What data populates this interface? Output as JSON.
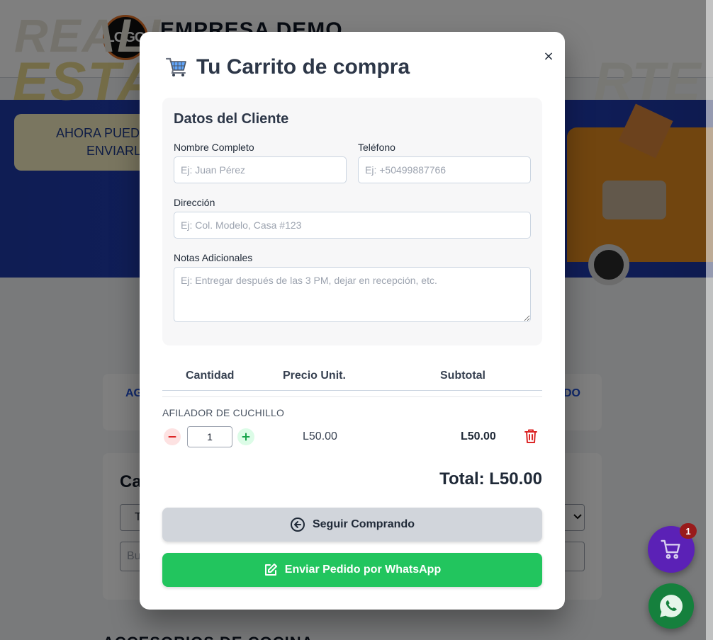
{
  "background": {
    "logo_text": "LOGO",
    "brand": "EMPRESA DEMO",
    "banner": {
      "line1": "REALI",
      "line2": "ESTA",
      "line2_right": "RTE",
      "sub1": "AHORA PUED",
      "sub2": "ENVIARL"
    },
    "nav_left": "AG",
    "nav_right": "DO",
    "filter_title": "Ca",
    "filter_select": "T",
    "search_placeholder": "Bu",
    "section_title": "ACCESORIOS DE COCINA"
  },
  "modal": {
    "cart_icon": "🛒",
    "title": "Tu Carrito de compra",
    "close_label": "×",
    "client": {
      "title": "Datos del Cliente",
      "name_label": "Nombre Completo",
      "name_placeholder": "Ej: Juan Pérez",
      "phone_label": "Teléfono",
      "phone_placeholder": "Ej: +50499887766",
      "address_label": "Dirección",
      "address_placeholder": "Ej: Col. Modelo, Casa #123",
      "notes_label": "Notas Adicionales",
      "notes_placeholder": "Ej: Entregar después de las 3 PM, dejar en recepción, etc."
    },
    "table": {
      "headers": [
        "Cantidad",
        "Precio Unit.",
        "Subtotal"
      ],
      "items": [
        {
          "name": "AFILADOR DE CUCHILLO",
          "quantity": "1",
          "unit_price": "L50.00",
          "subtotal": "L50.00"
        }
      ]
    },
    "total": "Total: L50.00",
    "continue_label": "Seguir Comprando",
    "whatsapp_label": "Enviar Pedido por WhatsApp"
  },
  "floating": {
    "cart_badge": "1"
  },
  "colors": {
    "accent_green": "#22c55e",
    "cart_fab": "#5b21b6",
    "danger": "#dc2626"
  }
}
